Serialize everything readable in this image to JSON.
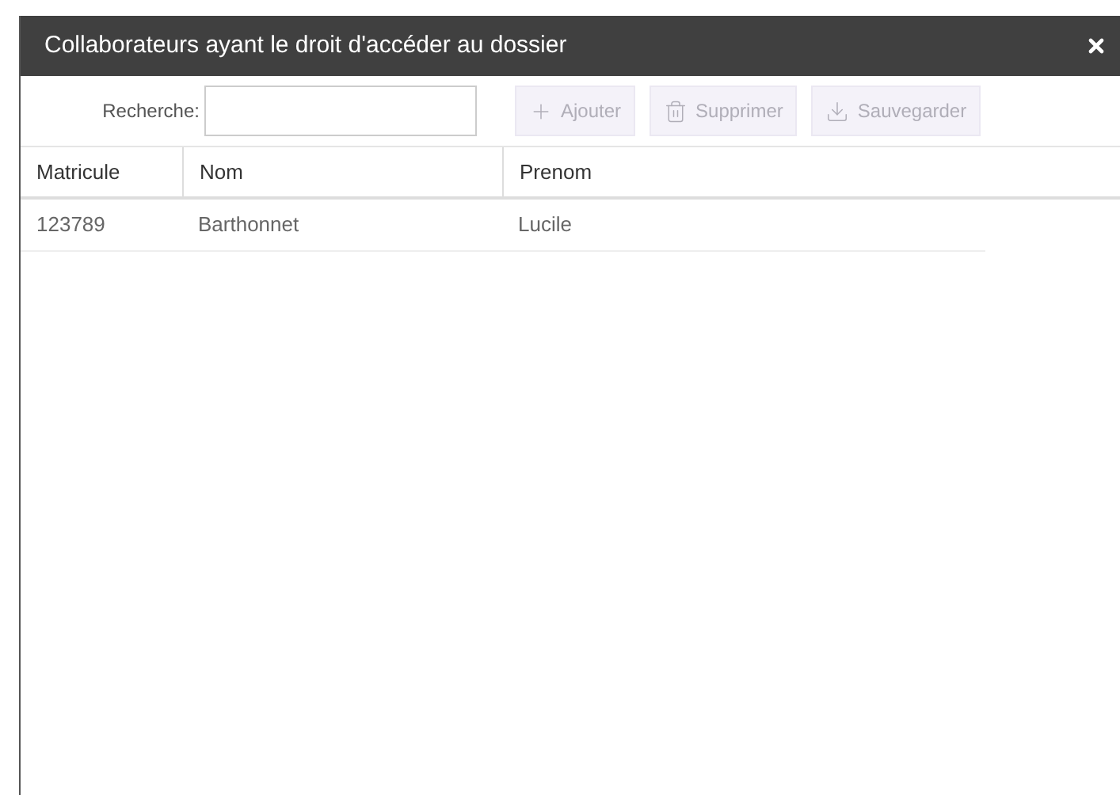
{
  "window": {
    "title": "Collaborateurs ayant le droit d'accéder au dossier"
  },
  "search": {
    "label": "Recherche:"
  },
  "buttons": [
    {
      "kind": "add",
      "label": "Ajouter",
      "disabled": true
    },
    {
      "kind": "delete",
      "label": "Supprimer",
      "disabled": true
    },
    {
      "kind": "save",
      "label": "Sauvegarder",
      "disabled": true
    }
  ],
  "table": {
    "columns": [
      "Matricule",
      "Nom",
      "Prenom"
    ],
    "rows": [
      [
        "123789",
        "Barthonnet",
        "Lucile"
      ]
    ]
  }
}
